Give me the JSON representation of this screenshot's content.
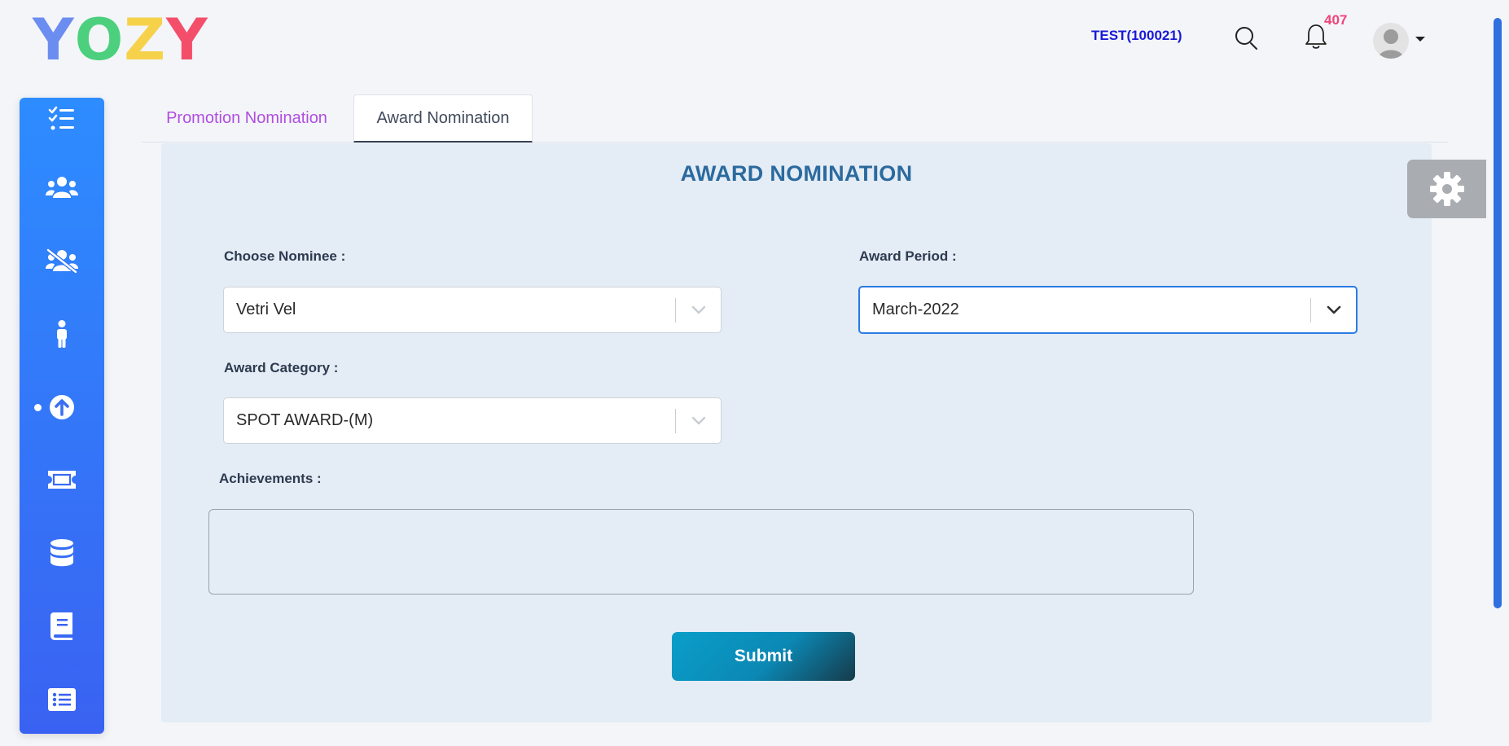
{
  "header": {
    "logo_letters": [
      {
        "char": "Y",
        "color": "#6c8df0"
      },
      {
        "char": "O",
        "color": "#4cd07d"
      },
      {
        "char": "Z",
        "color": "#f6d24a"
      },
      {
        "char": "Y",
        "color": "#f44f6a"
      }
    ],
    "user_code": "TEST(100021)",
    "notification_count": "407",
    "search_icon": "search-icon",
    "bell_icon": "bell-icon",
    "avatar_icon": "user-avatar"
  },
  "sidebar": {
    "accent_color": "#2d8cff",
    "items": [
      {
        "icon": "checklist-icon"
      },
      {
        "icon": "users-icon"
      },
      {
        "icon": "users-slash-icon"
      },
      {
        "icon": "person-icon"
      },
      {
        "icon": "arrow-up-circle-icon",
        "active": true
      },
      {
        "icon": "ticket-icon"
      },
      {
        "icon": "database-icon"
      },
      {
        "icon": "book-icon"
      },
      {
        "icon": "list-alt-icon"
      }
    ]
  },
  "tabs": [
    {
      "label": "Promotion Nomination",
      "active": false
    },
    {
      "label": "Award Nomination",
      "active": true
    }
  ],
  "form": {
    "title": "AWARD NOMINATION",
    "nominee_label": "Choose Nominee :",
    "nominee_value": "Vetri Vel",
    "period_label": "Award Period :",
    "period_value": "March-2022",
    "category_label": "Award Category :",
    "category_value": "SPOT AWARD-(M)",
    "achievements_label": "Achievements :",
    "achievements_value": "",
    "submit_label": "Submit"
  },
  "settings_icon": "gear-icon"
}
